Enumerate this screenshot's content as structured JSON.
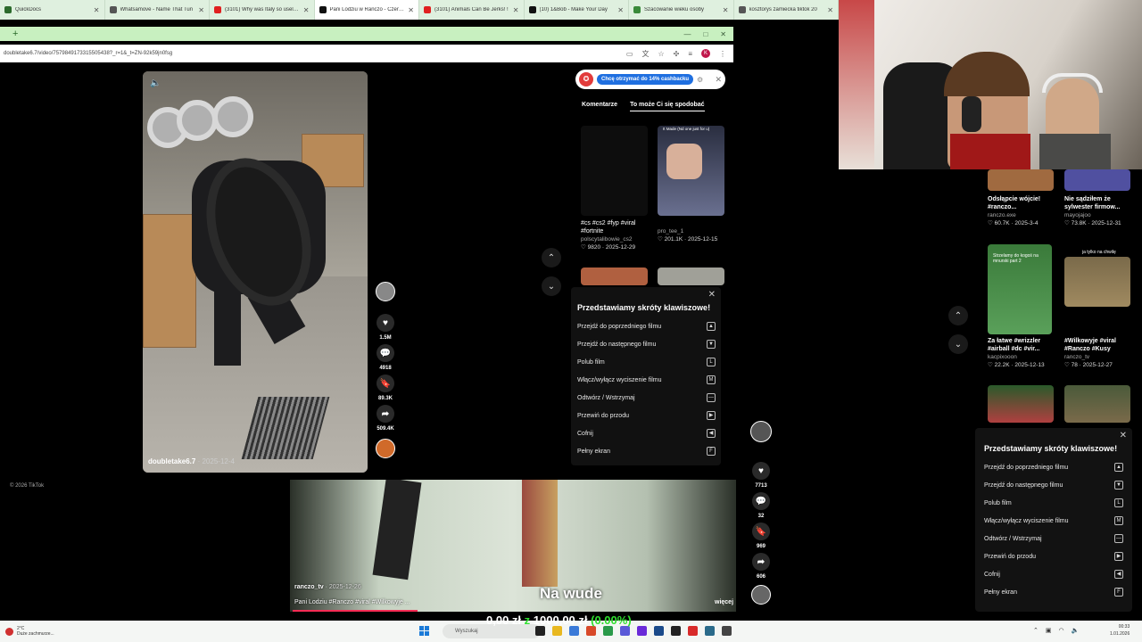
{
  "browser_tabs": [
    {
      "title": "QuickDocs",
      "active": false,
      "color": "#2c6a2c"
    },
    {
      "title": "Whatsamove - Name That Tun",
      "active": false,
      "color": "#555555"
    },
    {
      "title": "(3101) Why was Italy so useless",
      "active": false,
      "color": "#e02020"
    },
    {
      "title": "Pani Lodziu w Ranczo - Czerpani",
      "active": true,
      "color": "#111111"
    },
    {
      "title": "(3101) Animals Can Be Jerks! !",
      "active": false,
      "color": "#e02020"
    },
    {
      "title": "(10) 1&Bob - Make Your Day",
      "active": false,
      "color": "#111111"
    },
    {
      "title": "Szacowanie wieku osoby",
      "active": false,
      "color": "#3a8a3a"
    },
    {
      "title": "kosztorys zamiecka tiktok 20",
      "active": false,
      "color": "#555555"
    }
  ],
  "window": {
    "new_tab": "+",
    "minimize": "—",
    "maximize": "□",
    "close": "✕"
  },
  "address_bar": {
    "url": "doubletake6.7/video/7579849173315505438?_r=1&_t=ZN-92k59jn0fsg",
    "profile_initial": "K"
  },
  "video": {
    "username": "doubletake6.7",
    "date": "· 2025-12-4",
    "likes": "1.5M",
    "comments": "4918",
    "saves": "89.3K",
    "shares": "509.4K"
  },
  "cashback": {
    "label": "Chcę otrzymać do 14% cashbacku"
  },
  "side_tabs": {
    "comments": "Komentarze",
    "suggested": "To może Ci się spodobać"
  },
  "suggested": [
    {
      "title": "#cs #cs2 #fyp #viral #fortnite",
      "user": "polscytalibowie_cs2",
      "likes": "9820",
      "date": "2025-12-29"
    },
    {
      "title": "",
      "user": "pro_tee_1",
      "likes": "201.1K",
      "date": "2025-12-15",
      "overlay": "It Made (Nd one just for u)"
    }
  ],
  "shortcuts": {
    "title": "Przedstawiamy skróty klawiszowe!",
    "items": [
      {
        "label": "Przejdź do poprzedniego filmu",
        "key": "▲"
      },
      {
        "label": "Przejdź do następnego filmu",
        "key": "▼"
      },
      {
        "label": "Polub film",
        "key": "L"
      },
      {
        "label": "Włącz/wyłącz wyciszenie filmu",
        "key": "M"
      },
      {
        "label": "Odtwórz / Wstrzymaj",
        "key": "—"
      },
      {
        "label": "Przewiń do przodu",
        "key": "▶"
      },
      {
        "label": "Cofnij",
        "key": "◀"
      },
      {
        "label": "Pełny ekran",
        "key": "F"
      }
    ]
  },
  "footer_copyright": "© 2026 TikTok",
  "outer_side": {
    "likes": "7713",
    "comments": "32",
    "saves": "969",
    "shares": "606"
  },
  "outer_suggested": [
    {
      "title": "Odsłąpcie wójcie! #ranczo...",
      "user": "ranczo.exe",
      "likes": "60.7K",
      "date": "2025-3-4"
    },
    {
      "title": "Nie sądziłem że sylwester firmow...",
      "user": "mayojajoo",
      "likes": "73.8K",
      "date": "2025-12-31"
    },
    {
      "title": "Za łatwe #wrizzler #airball #dc #vir...",
      "user": "kacpixooon",
      "likes": "22.2K",
      "date": "2025-12-13",
      "overlay": "Strzelamy do kogoś na mnurski part 2"
    },
    {
      "title": "#Wilkowyje #viral #Ranczo #Kusy",
      "user": "ranczo_tv",
      "likes": "78",
      "date": "2025-12-27",
      "overlay": "ja tylko na chwilę"
    }
  ],
  "bottom_video": {
    "subtitle": "Na wude",
    "username": "ranczo_tv",
    "date": "· 2025-12-26",
    "caption": "Pani Lodziu #Ranczo #viral #Wilkowyje ...",
    "more": "więcej"
  },
  "ticker": {
    "left": "0,00 zł",
    "mid": "z",
    "right": "1000,00 zł",
    "pct": "(0.00%)"
  },
  "taskbar": {
    "weather_temp": "2°C",
    "weather_desc": "Duże zachmurze...",
    "search_placeholder": "Wyszukaj",
    "time": "00:33",
    "date": "1.01.2026"
  }
}
